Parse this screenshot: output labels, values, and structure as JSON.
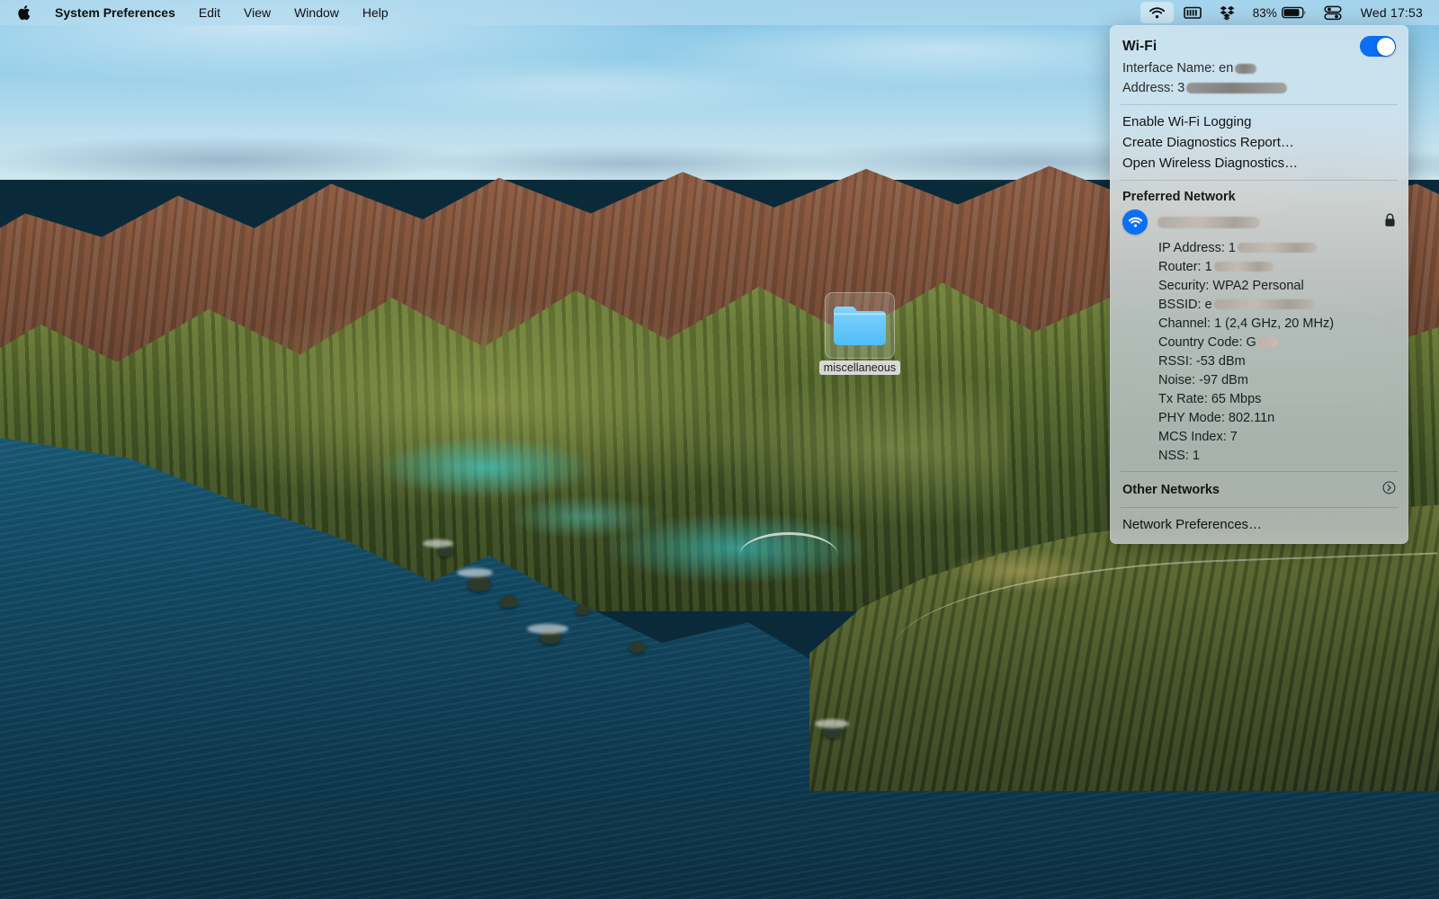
{
  "menubar": {
    "apple_icon": "apple-logo-icon",
    "items": [
      {
        "label": "System Preferences",
        "bold": true
      },
      {
        "label": "Edit",
        "bold": false
      },
      {
        "label": "View",
        "bold": false
      },
      {
        "label": "Window",
        "bold": false
      },
      {
        "label": "Help",
        "bold": false
      }
    ],
    "status": {
      "wifi_icon": "wifi-icon",
      "battery_menu_icon": "battery-menu-icon",
      "dropbox_icon": "dropbox-icon",
      "battery_percent": "83%",
      "battery_icon": "battery-icon",
      "control_center_icon": "control-center-icon",
      "clock": "Wed 17:53"
    }
  },
  "desktop": {
    "folder": {
      "name": "miscellaneous",
      "icon": "folder-icon",
      "selected": true
    }
  },
  "wifi_menu": {
    "title": "Wi-Fi",
    "toggle_on": true,
    "toggle_color": "#0a6ff5",
    "interface_label": "Interface Name: en",
    "interface_redacted": true,
    "address_label": "Address: 3",
    "address_redacted": true,
    "actions": [
      "Enable Wi-Fi Logging",
      "Create Diagnostics Report…",
      "Open Wireless Diagnostics…"
    ],
    "preferred_network_heading": "Preferred Network",
    "network": {
      "ssid_redacted": true,
      "wifi_badge_icon": "wifi-connected-icon",
      "lock_icon": "lock-icon"
    },
    "details": [
      {
        "label": "IP Address: 1",
        "redacted": true
      },
      {
        "label": "Router: 1",
        "redacted": true
      },
      {
        "label": "Security: WPA2 Personal",
        "redacted": false
      },
      {
        "label": "BSSID: e",
        "redacted": true
      },
      {
        "label": "Channel: 1 (2,4 GHz, 20 MHz)",
        "redacted": false
      },
      {
        "label": "Country Code: G",
        "redacted": true
      },
      {
        "label": "RSSI: -53 dBm",
        "redacted": false
      },
      {
        "label": "Noise: -97 dBm",
        "redacted": false
      },
      {
        "label": "Tx Rate: 65 Mbps",
        "redacted": false
      },
      {
        "label": "PHY Mode: 802.11n",
        "redacted": false
      },
      {
        "label": "MCS Index: 7",
        "redacted": false
      },
      {
        "label": "NSS: 1",
        "redacted": false
      }
    ],
    "other_networks": "Other Networks",
    "other_networks_icon": "chevron-right-circle-icon",
    "network_preferences": "Network Preferences…"
  }
}
